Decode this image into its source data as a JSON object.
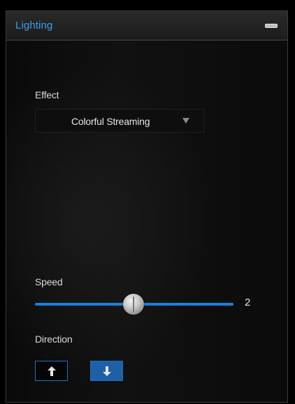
{
  "panel": {
    "title": "Lighting",
    "collapse_icon": "minus-icon"
  },
  "effect": {
    "label": "Effect",
    "selected": "Colorful Streaming",
    "arrow_icon": "chevron-down-icon"
  },
  "speed": {
    "label": "Speed",
    "value": "2",
    "min": 1,
    "max": 3,
    "level": 2
  },
  "direction": {
    "label": "Direction",
    "buttons": [
      {
        "icon": "arrow-up-icon",
        "selected": false
      },
      {
        "icon": "arrow-down-icon",
        "selected": true
      }
    ]
  },
  "colors": {
    "accent": "#3aa0e8",
    "slider": "#1e7fd6",
    "selected_button": "#1f5fa8",
    "background": "#000000"
  }
}
